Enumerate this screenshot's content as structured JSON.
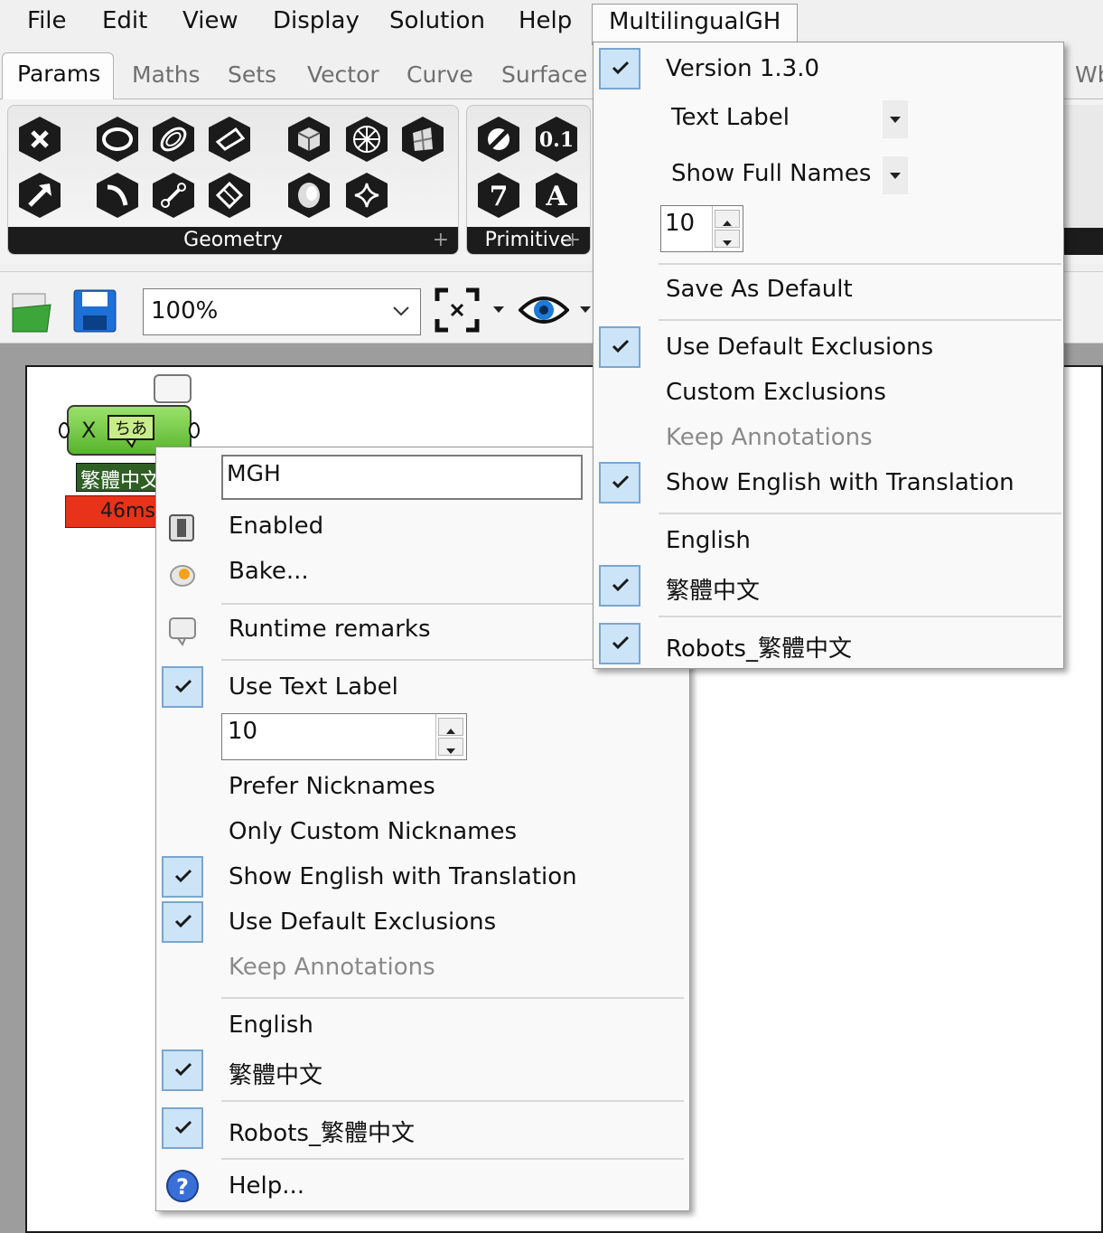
{
  "menubar": {
    "items": [
      "File",
      "Edit",
      "View",
      "Display",
      "Solution",
      "Help"
    ],
    "active": "MultilingualGH"
  },
  "tabs": {
    "active": "Params",
    "items": [
      "Maths",
      "Sets",
      "Vector",
      "Curve",
      "Surface"
    ],
    "overflow": "Wb"
  },
  "ribbon": {
    "geometry_label": "Geometry",
    "primitive_label": "Primitive",
    "primitive_values": [
      "0.1",
      "7",
      "A"
    ]
  },
  "toolbar": {
    "zoom": "100%"
  },
  "component": {
    "input_name": "X",
    "label": "繁體中文",
    "time": "46ms",
    "icon_text": "ちあ"
  },
  "context_menu": {
    "name_value": "MGH",
    "enabled": "Enabled",
    "bake": "Bake...",
    "runtime_remarks": "Runtime remarks",
    "use_text_label": "Use Text Label",
    "size_value": "10",
    "prefer_nicknames": "Prefer Nicknames",
    "only_custom_nicknames": "Only Custom Nicknames",
    "show_english": "Show English with Translation",
    "use_default_exclusions": "Use Default Exclusions",
    "keep_annotations": "Keep Annotations",
    "lang_english": "English",
    "lang_trad_chinese": "繁體中文",
    "robots_trad_chinese": "Robots_繁體中文",
    "help": "Help..."
  },
  "dropdown_menu": {
    "version": "Version 1.3.0",
    "label_mode": "Text Label",
    "name_mode": "Show Full Names",
    "size_value": "10",
    "save_default": "Save As Default",
    "use_default_exclusions": "Use Default Exclusions",
    "custom_exclusions": "Custom Exclusions",
    "keep_annotations": "Keep Annotations",
    "show_english": "Show English with Translation",
    "lang_english": "English",
    "lang_trad_chinese": "繁體中文",
    "robots_trad_chinese": "Robots_繁體中文"
  },
  "colors": {
    "check_bg": "#cce4f7",
    "component_green": "#58b42d",
    "time_red": "#e8321a"
  }
}
